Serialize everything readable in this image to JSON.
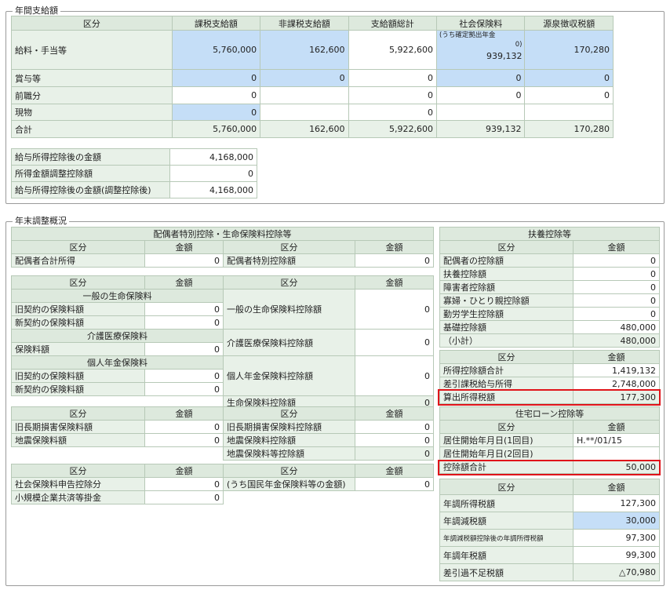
{
  "annual": {
    "legend": "年間支給額",
    "headers": [
      "区分",
      "課税支給額",
      "非課税支給額",
      "支給額総計",
      "社会保険料",
      "源泉徴収税額"
    ],
    "salary": {
      "label": "給料・手当等",
      "taxable": "5,760,000",
      "nontax": "162,600",
      "total": "5,922,600",
      "si_note": "(うち確定拠出年金",
      "si_note_val": "0)",
      "si": "939,132",
      "wh": "170,280"
    },
    "bonus": {
      "label": "賞与等",
      "taxable": "0",
      "nontax": "0",
      "total": "0",
      "si": "0",
      "wh": "0"
    },
    "prev": {
      "label": "前職分",
      "taxable": "0",
      "total": "0",
      "si": "0",
      "wh": "0"
    },
    "kind": {
      "label": "現物",
      "taxable": "0",
      "total": "0"
    },
    "sum": {
      "label": "合計",
      "taxable": "5,760,000",
      "nontax": "162,600",
      "total": "5,922,600",
      "si": "939,132",
      "wh": "170,280"
    },
    "after": [
      {
        "label": "給与所得控除後の金額",
        "value": "4,168,000"
      },
      {
        "label": "所得金額調整控除額",
        "value": "0"
      },
      {
        "label": "給与所得控除後の金額(調整控除後)",
        "value": "4,168,000"
      }
    ]
  },
  "yearend": {
    "legend": "年末調整概況",
    "spouse_title": "配偶者特別控除・生命保険料控除等",
    "kubun": "区分",
    "kingaku": "金額",
    "spouse_income_label": "配偶者合計所得",
    "spouse_income": "0",
    "spouse_special_label": "配偶者特別控除額",
    "spouse_special": "0",
    "life_general_title": "一般の生命保険料",
    "old_contract": "旧契約の保険料額",
    "old_val": "0",
    "new_contract": "新契約の保険料額",
    "new_val": "0",
    "general_deduct_label": "一般の生命保険料控除額",
    "general_deduct": "0",
    "care_title": "介護医療保険料",
    "care_premium_label": "保険料額",
    "care_premium": "0",
    "care_deduct_label": "介護医療保険料控除額",
    "care_deduct": "0",
    "pension_title": "個人年金保険料",
    "pension_old": "0",
    "pension_new": "0",
    "pension_deduct_label": "個人年金保険料控除額",
    "pension_deduct": "0",
    "life_total_label": "生命保険料控除額",
    "life_total": "0",
    "old_longterm_label": "旧長期損害保険料額",
    "old_longterm": "0",
    "quake_label": "地震保険料額",
    "quake": "0",
    "old_longterm_deduct_label": "旧長期損害保険料控除額",
    "old_longterm_deduct": "0",
    "quake_deduct_label": "地震保険料控除額",
    "quake_deduct": "0",
    "quake_total_label": "地震保険料等控除額",
    "quake_total": "0",
    "social_label": "社会保険料申告控除分",
    "social": "0",
    "smallbiz_label": "小規模企業共済等掛金",
    "smallbiz": "0",
    "national_pension_label": "(うち国民年金保険料等の金額)",
    "national_pension": "0",
    "dependents_title": "扶養控除等",
    "dependents": [
      {
        "label": "配偶者の控除額",
        "value": "0"
      },
      {
        "label": "扶養控除額",
        "value": "0"
      },
      {
        "label": "障害者控除額",
        "value": "0"
      },
      {
        "label": "寡婦・ひとり親控除額",
        "value": "0"
      },
      {
        "label": "勤労学生控除額",
        "value": "0"
      },
      {
        "label": "基礎控除額",
        "value": "480,000"
      },
      {
        "label": "（小計）",
        "value": "480,000"
      }
    ],
    "calc": [
      {
        "label": "所得控除額合計",
        "value": "1,419,132"
      },
      {
        "label": "差引課税給与所得",
        "value": "2,748,000"
      },
      {
        "label": "算出所得税額",
        "value": "177,300"
      }
    ],
    "housing_title": "住宅ローン控除等",
    "housing": [
      {
        "label": "居住開始年月日(1回目)",
        "value": "H.**/01/15"
      },
      {
        "label": "居住開始年月日(2回目)",
        "value": ""
      },
      {
        "label": "控除額合計",
        "value": "50,000"
      }
    ],
    "final": [
      {
        "label": "年調所得税額",
        "value": "127,300"
      },
      {
        "label": "年調減税額",
        "value": "30,000"
      },
      {
        "label": "年調減税額控除後の年調所得税額",
        "value": "97,300"
      },
      {
        "label": "年調年税額",
        "value": "99,300"
      },
      {
        "label": "差引過不足税額",
        "value": "△70,980"
      }
    ]
  }
}
